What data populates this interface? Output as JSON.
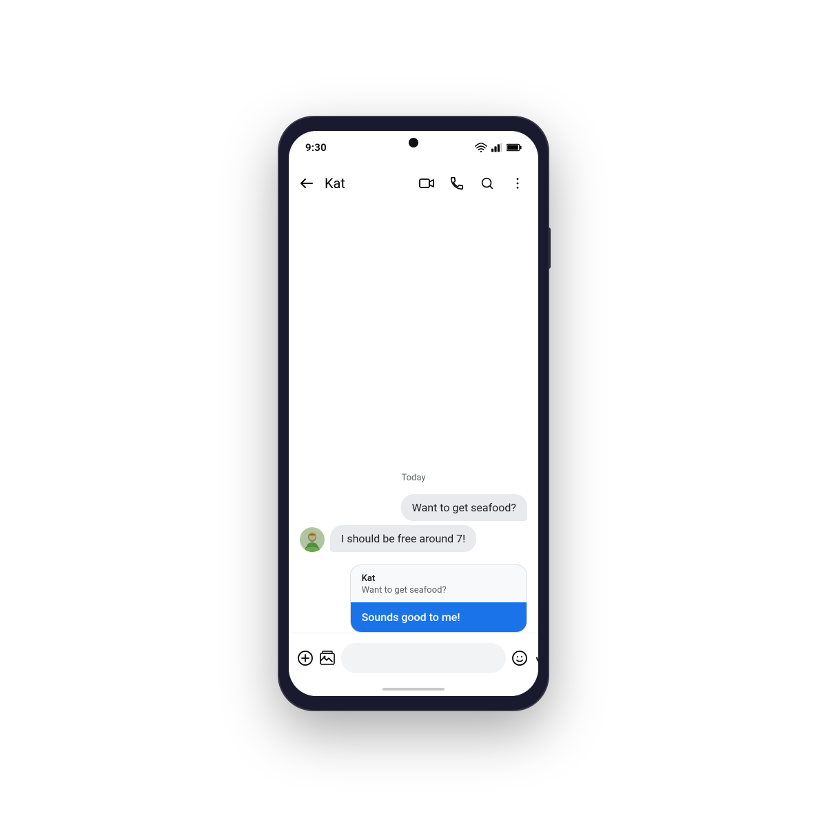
{
  "statusBar": {
    "time": "9:30"
  },
  "header": {
    "title": "Kat",
    "backLabel": "back",
    "videoCallLabel": "video call",
    "phoneLabel": "phone call",
    "searchLabel": "search",
    "moreLabel": "more options"
  },
  "chat": {
    "dateLabel": "Today",
    "messages": [
      {
        "type": "outgoing",
        "text": "Want to get seafood?"
      },
      {
        "type": "incoming",
        "text": "I should be free around 7!",
        "sender": "Kat"
      }
    ],
    "smartReply": {
      "sender": "Kat",
      "preview": "Want to get seafood?",
      "suggestion": "Sounds good to me!"
    }
  },
  "inputBar": {
    "placeholder": "",
    "addLabel": "add",
    "galleryLabel": "gallery",
    "emojiLabel": "emoji",
    "voiceLabel": "voice"
  }
}
